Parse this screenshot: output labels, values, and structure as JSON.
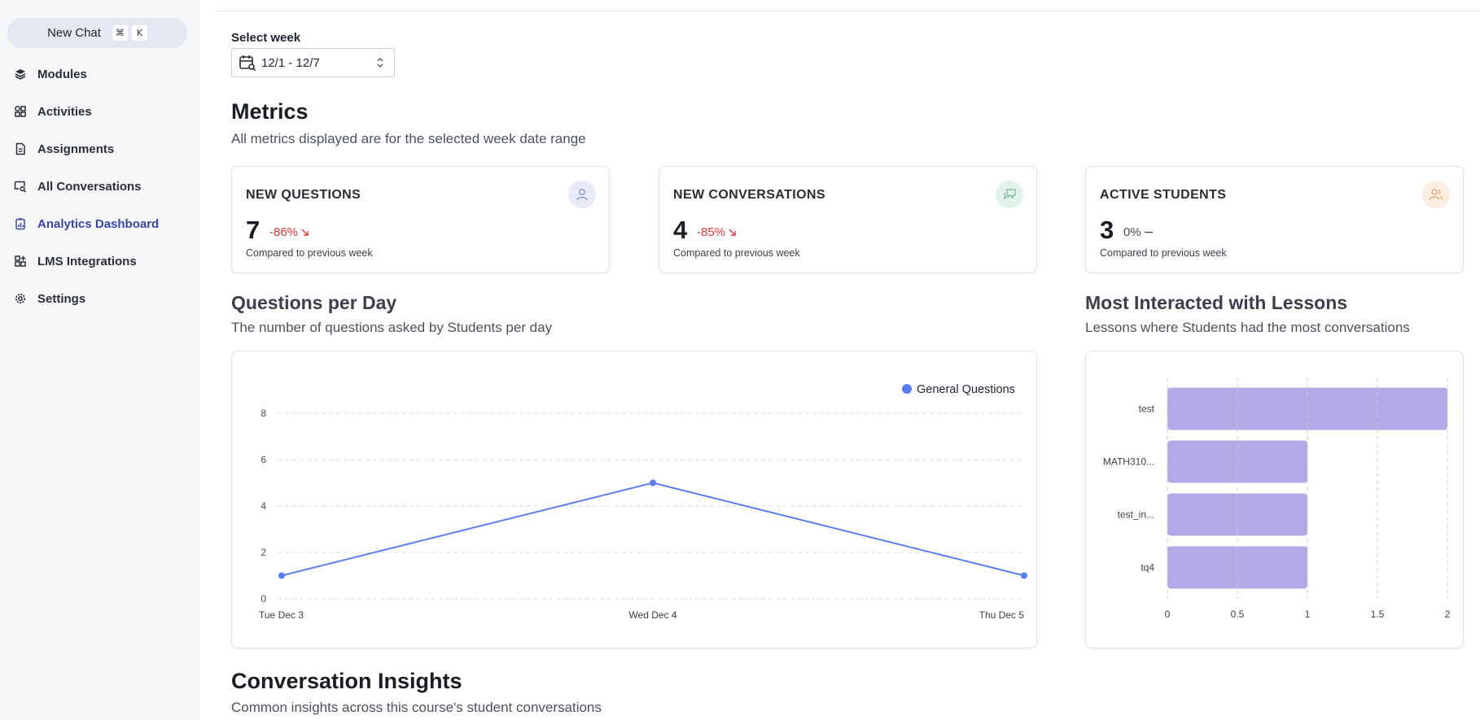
{
  "sidebar": {
    "new_chat": "New Chat",
    "shortcut_keys": [
      "⌘",
      "K"
    ],
    "items": [
      {
        "label": "Modules",
        "icon": "layers-icon"
      },
      {
        "label": "Activities",
        "icon": "shapes-icon"
      },
      {
        "label": "Assignments",
        "icon": "document-icon"
      },
      {
        "label": "All Conversations",
        "icon": "message-search-icon"
      },
      {
        "label": "Analytics Dashboard",
        "icon": "clipboard-chart-icon",
        "active": true
      },
      {
        "label": "LMS Integrations",
        "icon": "grid-plus-icon"
      },
      {
        "label": "Settings",
        "icon": "gear-icon"
      }
    ]
  },
  "week_select": {
    "label": "Select week",
    "value": "12/1 - 12/7"
  },
  "metrics": {
    "title": "Metrics",
    "subtitle": "All metrics displayed are for the selected week date range",
    "cards": [
      {
        "title": "NEW QUESTIONS",
        "value": "7",
        "change": "-86%",
        "trend": "down",
        "footer": "Compared to previous week",
        "icon": "user-icon",
        "icon_bg": "#e6ebf7",
        "change_color": "#d63a3a"
      },
      {
        "title": "NEW CONVERSATIONS",
        "value": "4",
        "change": "-85%",
        "trend": "down",
        "footer": "Compared to previous week",
        "icon": "chat-bubbles-icon",
        "icon_bg": "#e2f3ea",
        "change_color": "#d63a3a"
      },
      {
        "title": "ACTIVE STUDENTS",
        "value": "3",
        "change": "0%",
        "trend": "flat",
        "footer": "Compared to previous week",
        "icon": "users-icon",
        "icon_bg": "#fbeee0",
        "change_color": "#444a55"
      }
    ]
  },
  "questions_per_day": {
    "title": "Questions per Day",
    "subtitle": "The number of questions asked by Students per day"
  },
  "lessons": {
    "title": "Most Interacted with Lessons",
    "subtitle": "Lessons where Students had the most conversations"
  },
  "insights": {
    "title": "Conversation Insights",
    "subtitle": "Common insights across this course's student conversations"
  },
  "chart_data": [
    {
      "type": "line",
      "title": "",
      "x": [
        "Tue Dec 3",
        "Wed Dec 4",
        "Thu Dec 5"
      ],
      "series": [
        {
          "name": "General Questions",
          "values": [
            1,
            5,
            1
          ],
          "color": "#5b7cf0"
        }
      ],
      "ylim": [
        0,
        8
      ],
      "yticks": [
        "0",
        "2",
        "4",
        "6",
        "8"
      ],
      "grid": true,
      "legend": "top-right"
    },
    {
      "type": "bar",
      "orientation": "horizontal",
      "title": "",
      "categories": [
        "test",
        "MATH310...",
        "test_in...",
        "tq4"
      ],
      "values": [
        2,
        1,
        1,
        1
      ],
      "color": "#b3a9e6",
      "xlim": [
        0,
        2
      ],
      "xticks": [
        "0",
        "0.5",
        "1",
        "1.5",
        "2"
      ],
      "grid": true
    }
  ]
}
